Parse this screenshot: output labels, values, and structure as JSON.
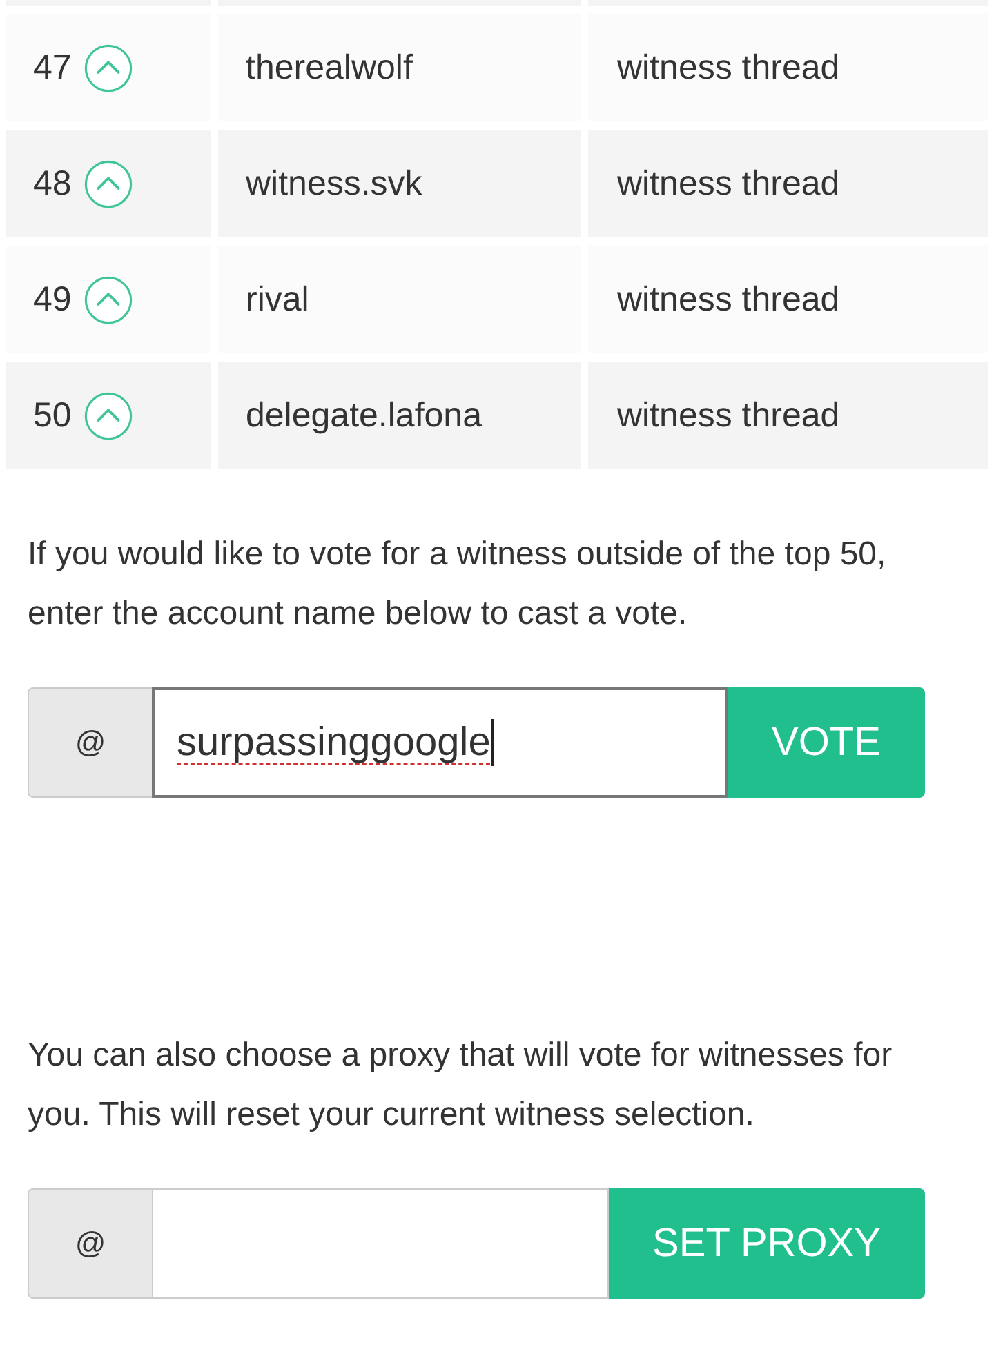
{
  "table": {
    "rows": [
      {
        "rank": "47",
        "voted": false,
        "account": "therealwolf",
        "thread_link": "witness thread"
      },
      {
        "rank": "48",
        "voted": false,
        "account": "witness.svk",
        "thread_link": "witness thread"
      },
      {
        "rank": "49",
        "voted": false,
        "account": "rival",
        "thread_link": "witness thread"
      },
      {
        "rank": "50",
        "voted": false,
        "account": "delegate.lafona",
        "thread_link": "witness thread"
      }
    ]
  },
  "vote_form": {
    "text": "If you would like to vote for a witness outside of the top 50, enter the account name below to cast a vote.",
    "prefix": "@",
    "input": {
      "value": "surpassinggoogle",
      "focused": true,
      "misspelled": true
    },
    "button": "VOTE"
  },
  "proxy_form": {
    "text": "You can also choose a proxy that will vote for witnesses for you. This will reset your current witness selection.",
    "prefix": "@",
    "input": {
      "focused": false
    },
    "button": "SET PROXY"
  }
}
